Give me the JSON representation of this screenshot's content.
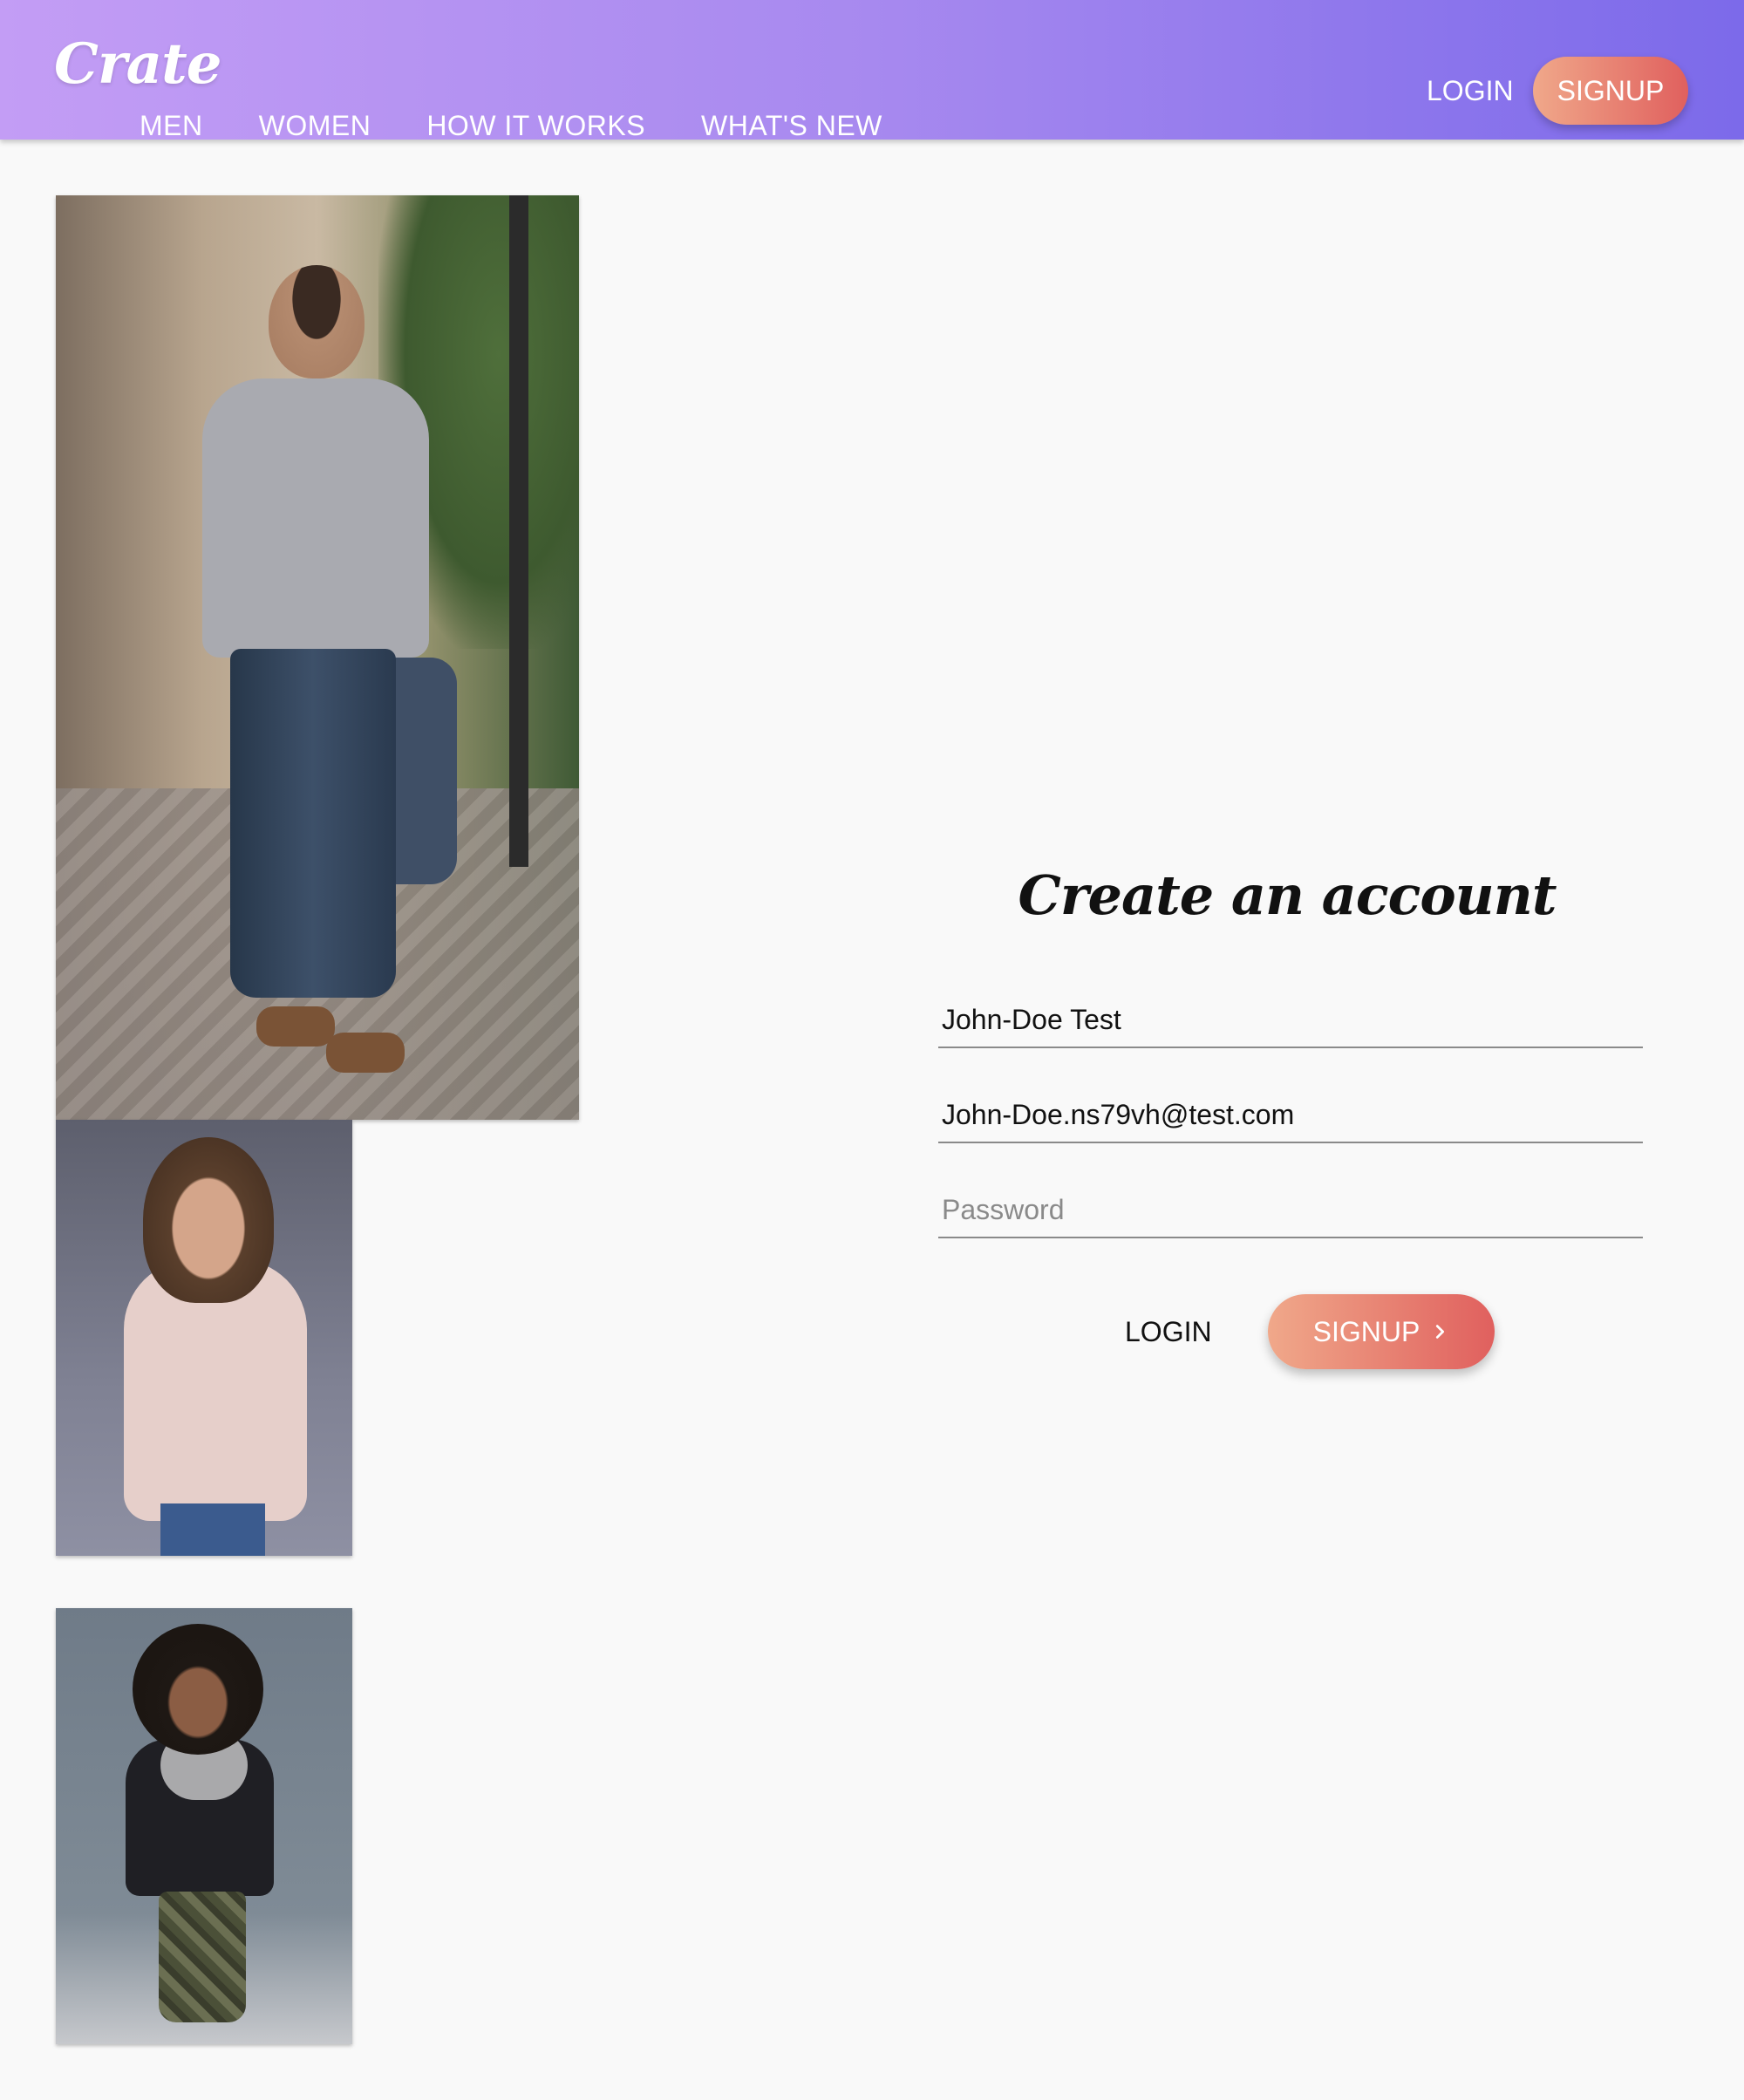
{
  "header": {
    "logo": "Crate",
    "nav": [
      "MEN",
      "WOMEN",
      "HOW IT WORKS",
      "WHAT'S NEW"
    ],
    "login_label": "LOGIN",
    "signup_label": "SIGNUP"
  },
  "images": [
    {
      "name": "man-walking-photo"
    },
    {
      "name": "woman-sweater-photo"
    },
    {
      "name": "woman-camo-photo"
    }
  ],
  "form": {
    "title": "Create an account",
    "name_value": "John-Doe Test",
    "email_value": "John-Doe.ns79vh@test.com",
    "password_placeholder": "Password",
    "login_label": "LOGIN",
    "signup_label": "SIGNUP",
    "signup_icon": "chevron-right-icon"
  },
  "colors": {
    "header_gradient_start": "#c39df5",
    "header_gradient_end": "#7c6aea",
    "button_gradient_start": "#f0a88a",
    "button_gradient_end": "#e0605e",
    "background": "#f9f9f9"
  }
}
